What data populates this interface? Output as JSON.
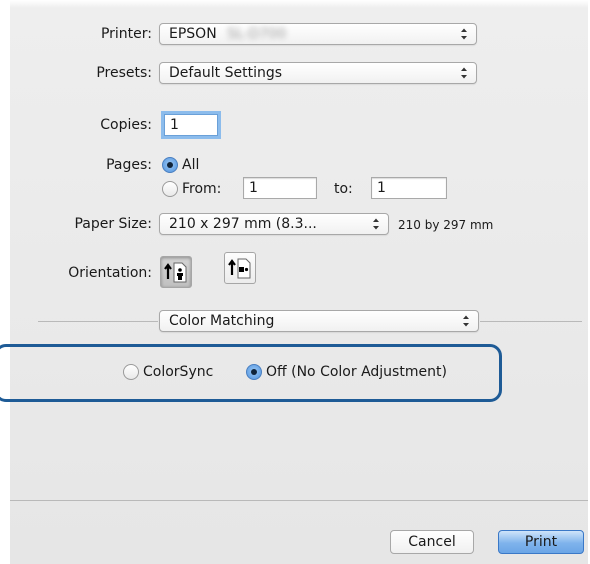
{
  "printer": {
    "label": "Printer:",
    "value": "EPSON",
    "redacted_suffix": "SL-D700"
  },
  "presets": {
    "label": "Presets:",
    "value": "Default Settings"
  },
  "copies": {
    "label": "Copies:",
    "value": "1"
  },
  "pages": {
    "label": "Pages:",
    "all_label": "All",
    "from_label": "From:",
    "from_value": "1",
    "to_label": "to:",
    "to_value": "1",
    "selected": "All"
  },
  "paper_size": {
    "label": "Paper Size:",
    "value": "210 x 297 mm (8.3...",
    "dimensions": "210 by 297 mm"
  },
  "orientation": {
    "label": "Orientation:",
    "options": [
      "portrait",
      "landscape"
    ],
    "selected": "portrait"
  },
  "section_menu": {
    "value": "Color Matching"
  },
  "color_matching": {
    "option_colorsync": "ColorSync",
    "option_off": "Off (No Color Adjustment)",
    "selected": "Off (No Color Adjustment)"
  },
  "buttons": {
    "cancel": "Cancel",
    "print": "Print"
  },
  "colors": {
    "highlight_border": "#1e5b96",
    "accent": "#4f93de",
    "focus_ring": "#8cbcec"
  }
}
